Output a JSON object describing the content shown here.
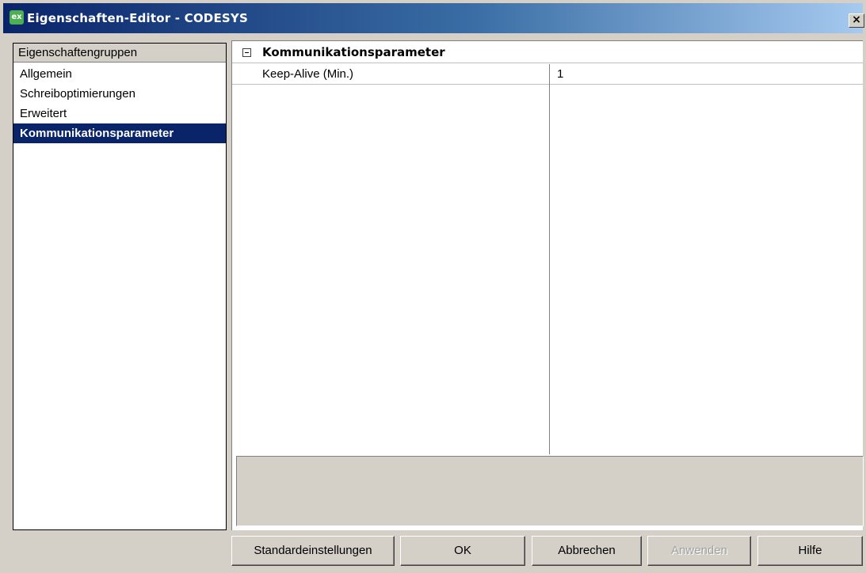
{
  "window": {
    "title": "Eigenschaften-Editor - CODESYS",
    "icon_label": "ex",
    "close_glyph": "×"
  },
  "left_panel": {
    "header": "Eigenschaftengruppen",
    "items": [
      {
        "label": "Allgemein",
        "selected": false
      },
      {
        "label": "Schreiboptimierungen",
        "selected": false
      },
      {
        "label": "Erweitert",
        "selected": false
      },
      {
        "label": "Kommunikationsparameter",
        "selected": true
      }
    ]
  },
  "property_grid": {
    "category": {
      "label": "Kommunikationsparameter",
      "expanded": true,
      "icon": "collapse-minus-icon"
    },
    "properties": [
      {
        "name": "Keep-Alive (Min.)",
        "value": "1"
      }
    ]
  },
  "buttons": {
    "defaults": "Standardeinstellungen",
    "ok": "OK",
    "cancel": "Abbrechen",
    "apply": "Anwenden",
    "help": "Hilfe"
  },
  "colors": {
    "selection": "#0a246a",
    "dialog_bg": "#d4d0c8",
    "disabled_text": "#a0a0a0"
  }
}
